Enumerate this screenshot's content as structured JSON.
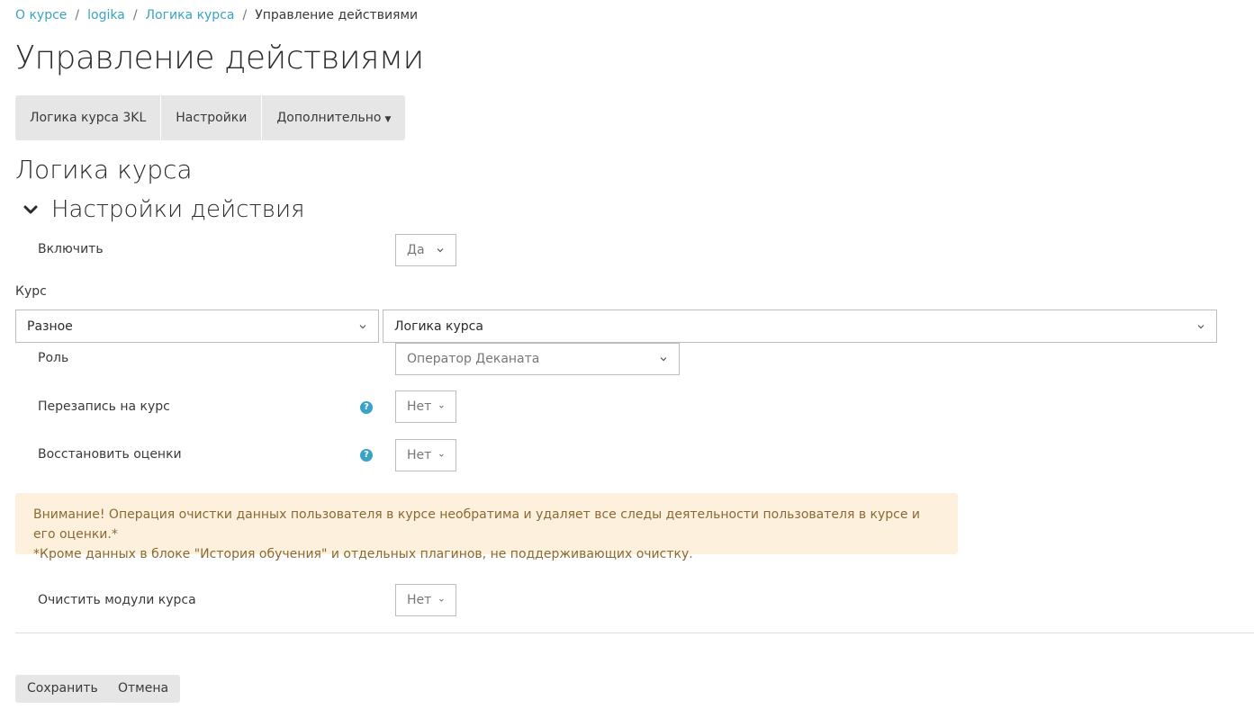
{
  "breadcrumb": {
    "items": [
      "О курсе",
      "logika",
      "Логика курса"
    ],
    "current": "Управление действиями",
    "separator": "/"
  },
  "page_title": "Управление действиями",
  "tabs": [
    {
      "label": "Логика курса 3KL"
    },
    {
      "label": "Настройки"
    },
    {
      "label": "Дополнительно"
    }
  ],
  "section_title": "Логика курса",
  "fieldset_legend": "Настройки действия",
  "form": {
    "enable": {
      "label": "Включить",
      "value": "Да"
    },
    "course": {
      "label": "Курс",
      "category_value": "Разное",
      "course_value": "Логика курса"
    },
    "role": {
      "label": "Роль",
      "value": "Оператор Деканата"
    },
    "reenrol": {
      "label": "Перезапись на курс",
      "value": "Нет"
    },
    "restore_grades": {
      "label": "Восстановить оценки",
      "value": "Нет"
    },
    "warning_line1": "Внимание! Операция очистки данных пользователя в курсе необратима и удаляет все следы деятельности пользователя в курсе и его оценки.*",
    "warning_line2": "*Кроме данных в блоке \"История обучения\" и отдельных плагинов, не поддерживающих очистку.",
    "clear_modules": {
      "label": "Очистить модули курса",
      "value": "Нет"
    }
  },
  "buttons": {
    "save": "Сохранить",
    "cancel": "Отмена"
  },
  "colors": {
    "link": "#3aa3c3",
    "help_icon": "#3aa3c3",
    "alert_bg": "#fdf1de",
    "alert_text": "#8a6a34",
    "tab_bg": "#e6e6e6"
  }
}
